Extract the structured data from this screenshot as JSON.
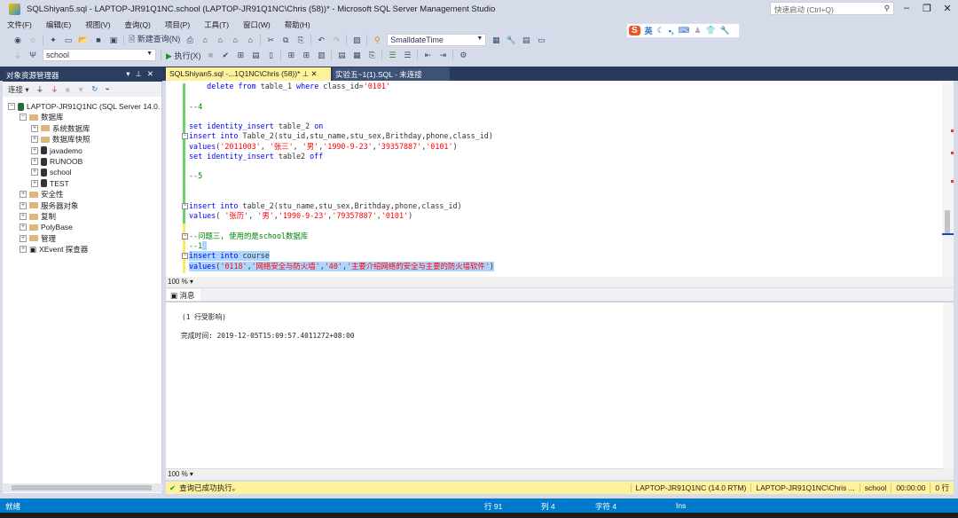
{
  "window": {
    "title": "SQLShiyan5.sql - LAPTOP-JR91Q1NC.school (LAPTOP-JR91Q1NC\\Chris (58))* - Microsoft SQL Server Management Studio",
    "quick_launch_placeholder": "快速启动 (Ctrl+Q)"
  },
  "menu": [
    "文件(F)",
    "编辑(E)",
    "视图(V)",
    "查询(Q)",
    "项目(P)",
    "工具(T)",
    "窗口(W)",
    "帮助(H)"
  ],
  "toolbar": {
    "new_query": "新建查询(N)",
    "type_combo": "SmalldateTime",
    "db_combo": "school",
    "execute": "执行(X)"
  },
  "ime": {
    "logo": "S",
    "mode": "英"
  },
  "object_explorer": {
    "title": "对象资源管理器",
    "connect": "连接",
    "tree": [
      {
        "label": "LAPTOP-JR91Q1NC (SQL Server 14.0.",
        "level": 0,
        "exp": "−",
        "icon": "server"
      },
      {
        "label": "数据库",
        "level": 1,
        "exp": "−",
        "icon": "folder"
      },
      {
        "label": "系统数据库",
        "level": 2,
        "exp": "+",
        "icon": "folder"
      },
      {
        "label": "数据库快照",
        "level": 2,
        "exp": "+",
        "icon": "folder"
      },
      {
        "label": "javademo",
        "level": 2,
        "exp": "+",
        "icon": "db"
      },
      {
        "label": "RUNOOB",
        "level": 2,
        "exp": "+",
        "icon": "db"
      },
      {
        "label": "school",
        "level": 2,
        "exp": "+",
        "icon": "db"
      },
      {
        "label": "TEST",
        "level": 2,
        "exp": "+",
        "icon": "db"
      },
      {
        "label": "安全性",
        "level": 1,
        "exp": "+",
        "icon": "folder"
      },
      {
        "label": "服务器对象",
        "level": 1,
        "exp": "+",
        "icon": "folder"
      },
      {
        "label": "复制",
        "level": 1,
        "exp": "+",
        "icon": "folder"
      },
      {
        "label": "PolyBase",
        "level": 1,
        "exp": "+",
        "icon": "folder"
      },
      {
        "label": "管理",
        "level": 1,
        "exp": "+",
        "icon": "folder"
      },
      {
        "label": "XEvent 探查器",
        "level": 1,
        "exp": "+",
        "icon": "xevent"
      }
    ]
  },
  "tabs": [
    {
      "label": "SQLShiyan5.sql -...1Q1NC\\Chris (58))*",
      "active": true
    },
    {
      "label": "实验五~1(1).SQL - 未连接",
      "active": false
    }
  ],
  "code_lines": [
    [
      [
        "kw",
        "    delete from "
      ],
      [
        "pl",
        "table_1 "
      ],
      [
        "kw",
        "where "
      ],
      [
        "pl",
        "class_id="
      ],
      [
        "str",
        "'0101'"
      ]
    ],
    [],
    [
      [
        "cmt",
        "--4"
      ]
    ],
    [],
    [
      [
        "kw",
        "set identity_insert "
      ],
      [
        "pl",
        "table_2 "
      ],
      [
        "kw",
        "on"
      ]
    ],
    [
      [
        "kw",
        "insert into "
      ],
      [
        "pl",
        "Table_2(stu_id,stu_name,stu_sex,Brithday,phone,class_id)"
      ]
    ],
    [
      [
        "kw",
        "values"
      ],
      [
        "pl",
        "("
      ],
      [
        "str",
        "'2011003'"
      ],
      [
        "pl",
        ", "
      ],
      [
        "str",
        "'张三'"
      ],
      [
        "pl",
        ", "
      ],
      [
        "str",
        "'男'"
      ],
      [
        "pl",
        ","
      ],
      [
        "str",
        "'1990-9-23'"
      ],
      [
        "pl",
        ","
      ],
      [
        "str",
        "'39357887'"
      ],
      [
        "pl",
        ","
      ],
      [
        "str",
        "'0101'"
      ],
      [
        "pl",
        ")"
      ]
    ],
    [
      [
        "kw",
        "set identity_insert "
      ],
      [
        "pl",
        "table2 "
      ],
      [
        "kw",
        "off"
      ]
    ],
    [],
    [
      [
        "cmt",
        "--5"
      ]
    ],
    [],
    [],
    [
      [
        "kw",
        "insert into "
      ],
      [
        "pl",
        "table_2(stu_name,stu_sex,Brithday,phone,class_id)"
      ]
    ],
    [
      [
        "kw",
        "values"
      ],
      [
        "pl",
        "( "
      ],
      [
        "str",
        "'张历'"
      ],
      [
        "pl",
        ", "
      ],
      [
        "str",
        "'男'"
      ],
      [
        "pl",
        ","
      ],
      [
        "str",
        "'1990-9-23'"
      ],
      [
        "pl",
        ","
      ],
      [
        "str",
        "'79357887'"
      ],
      [
        "pl",
        ","
      ],
      [
        "str",
        "'0101'"
      ],
      [
        "pl",
        ")"
      ]
    ],
    [],
    [
      [
        "cmt",
        "--问题三, 使用的是school数据库"
      ]
    ],
    [
      [
        "cmt",
        "--1"
      ]
    ],
    [
      [
        "kw",
        "insert into "
      ],
      [
        "pl",
        "course"
      ]
    ],
    [
      [
        "kw",
        "values"
      ],
      [
        "pl",
        "("
      ],
      [
        "str",
        "'0118'"
      ],
      [
        "pl",
        ","
      ],
      [
        "str",
        "'网络安全与防火墙'"
      ],
      [
        "pl",
        ","
      ],
      [
        "str",
        "'40'"
      ],
      [
        "pl",
        ","
      ],
      [
        "str",
        "'主要介绍网络的安全与主要的防火墙软件'"
      ],
      [
        "pl",
        ")"
      ]
    ]
  ],
  "editor_zoom": "100 %",
  "results": {
    "tab": "消息",
    "rows_affected": "(1 行受影响)",
    "completion": "完成时间: 2019-12-05T15:09:57.4011272+08:00",
    "zoom": "100 %"
  },
  "query_status": {
    "message": "查询已成功执行。",
    "server": "LAPTOP-JR91Q1NC (14.0 RTM)",
    "user": "LAPTOP-JR91Q1NC\\Chris ...",
    "database": "school",
    "time": "00:00:00",
    "rows": "0 行"
  },
  "status_bar": {
    "state": "就绪",
    "line": "行 91",
    "col": "列 4",
    "char": "字符 4",
    "mode": "Ins"
  },
  "colors": {
    "status_blue": "#007acc",
    "query_yellow": "#fff29d",
    "keyword": "#0000ff",
    "string": "#ff0000",
    "comment": "#008000"
  }
}
